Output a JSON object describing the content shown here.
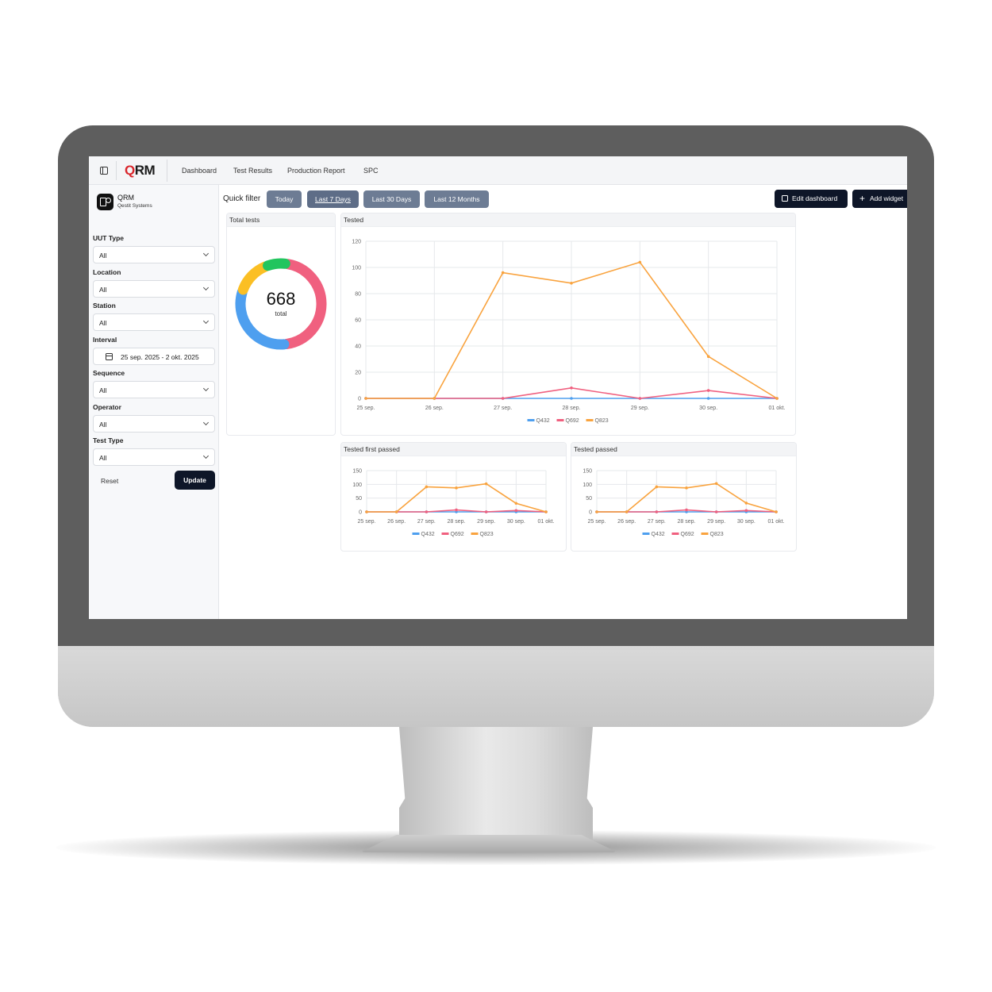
{
  "topbar": {
    "logo_q": "Q",
    "logo_rm": "RM",
    "nav": [
      "Dashboard",
      "Test Results",
      "Production Report",
      "SPC"
    ]
  },
  "sidebar": {
    "app_name": "QRM",
    "company": "Qestit Systems",
    "filters": [
      {
        "label": "UUT Type",
        "value": "All"
      },
      {
        "label": "Location",
        "value": "All"
      },
      {
        "label": "Station",
        "value": "All"
      },
      {
        "label": "Interval",
        "value": "25 sep. 2025 - 2 okt. 2025"
      },
      {
        "label": "Sequence",
        "value": "All"
      },
      {
        "label": "Operator",
        "value": "All"
      },
      {
        "label": "Test Type",
        "value": "All"
      }
    ],
    "reset_label": "Reset",
    "update_label": "Update"
  },
  "main": {
    "quick_filter_label": "Quick filter",
    "quick_filters": [
      "Today",
      "Last 7 Days",
      "Last 30 Days",
      "Last 12 Months"
    ],
    "active_quick_filter": "Last 7 Days",
    "edit_dashboard_label": "Edit dashboard",
    "add_widget_label": "Add widget"
  },
  "widgets": {
    "total_tests": {
      "title": "Total tests",
      "total": "668",
      "total_label": "total"
    },
    "tested": {
      "title": "Tested"
    },
    "tested_first_passed": {
      "title": "Tested first passed"
    },
    "tested_passed": {
      "title": "Tested passed"
    }
  },
  "colors": {
    "Q432": "#4e9fef",
    "Q692": "#f0607f",
    "Q823": "#f9a33e",
    "donut_green": "#22c55e",
    "donut_yellow": "#fbbf24",
    "accent_dark": "#0e1628",
    "button_slate": "#6d7c94"
  },
  "chart_data": [
    {
      "type": "donut",
      "title": "Total tests",
      "total": 668,
      "slices": [
        {
          "color": "#f0607f",
          "value": 0.46
        },
        {
          "color": "#4e9fef",
          "value": 0.32
        },
        {
          "color": "#fbbf24",
          "value": 0.14
        },
        {
          "color": "#22c55e",
          "value": 0.08
        }
      ]
    },
    {
      "type": "line",
      "title": "Tested",
      "categories": [
        "25 sep.",
        "26 sep.",
        "27 sep.",
        "28 sep.",
        "29 sep.",
        "30 sep.",
        "01 okt."
      ],
      "ylim": [
        0,
        120
      ],
      "yticks": [
        0,
        20,
        40,
        60,
        80,
        100,
        120
      ],
      "legend_position": "bottom",
      "grid": true,
      "series": [
        {
          "name": "Q432",
          "color": "#4e9fef",
          "values": [
            0,
            0,
            0,
            0,
            0,
            0,
            0
          ]
        },
        {
          "name": "Q692",
          "color": "#f0607f",
          "values": [
            0,
            0,
            0,
            8,
            0,
            6,
            0
          ]
        },
        {
          "name": "Q823",
          "color": "#f9a33e",
          "values": [
            0,
            0,
            96,
            88,
            104,
            32,
            0
          ]
        }
      ]
    },
    {
      "type": "line",
      "title": "Tested first passed",
      "categories": [
        "25 sep.",
        "26 sep.",
        "27 sep.",
        "28 sep.",
        "29 sep.",
        "30 sep.",
        "01 okt."
      ],
      "ylim": [
        0,
        150
      ],
      "yticks": [
        0,
        50,
        100,
        150
      ],
      "legend_position": "bottom",
      "grid": true,
      "series": [
        {
          "name": "Q432",
          "color": "#4e9fef",
          "values": [
            0,
            0,
            0,
            0,
            0,
            0,
            0
          ]
        },
        {
          "name": "Q692",
          "color": "#f0607f",
          "values": [
            0,
            0,
            0,
            7,
            0,
            5,
            0
          ]
        },
        {
          "name": "Q823",
          "color": "#f9a33e",
          "values": [
            0,
            0,
            91,
            87,
            102,
            31,
            0
          ]
        }
      ]
    },
    {
      "type": "line",
      "title": "Tested passed",
      "categories": [
        "25 sep.",
        "26 sep.",
        "27 sep.",
        "28 sep.",
        "29 sep.",
        "30 sep.",
        "01 okt."
      ],
      "ylim": [
        0,
        150
      ],
      "yticks": [
        0,
        50,
        100,
        150
      ],
      "legend_position": "bottom",
      "grid": true,
      "series": [
        {
          "name": "Q432",
          "color": "#4e9fef",
          "values": [
            0,
            0,
            0,
            0,
            0,
            0,
            0
          ]
        },
        {
          "name": "Q692",
          "color": "#f0607f",
          "values": [
            0,
            0,
            0,
            7,
            0,
            5,
            0
          ]
        },
        {
          "name": "Q823",
          "color": "#f9a33e",
          "values": [
            0,
            0,
            91,
            87,
            103,
            32,
            0
          ]
        }
      ]
    }
  ]
}
